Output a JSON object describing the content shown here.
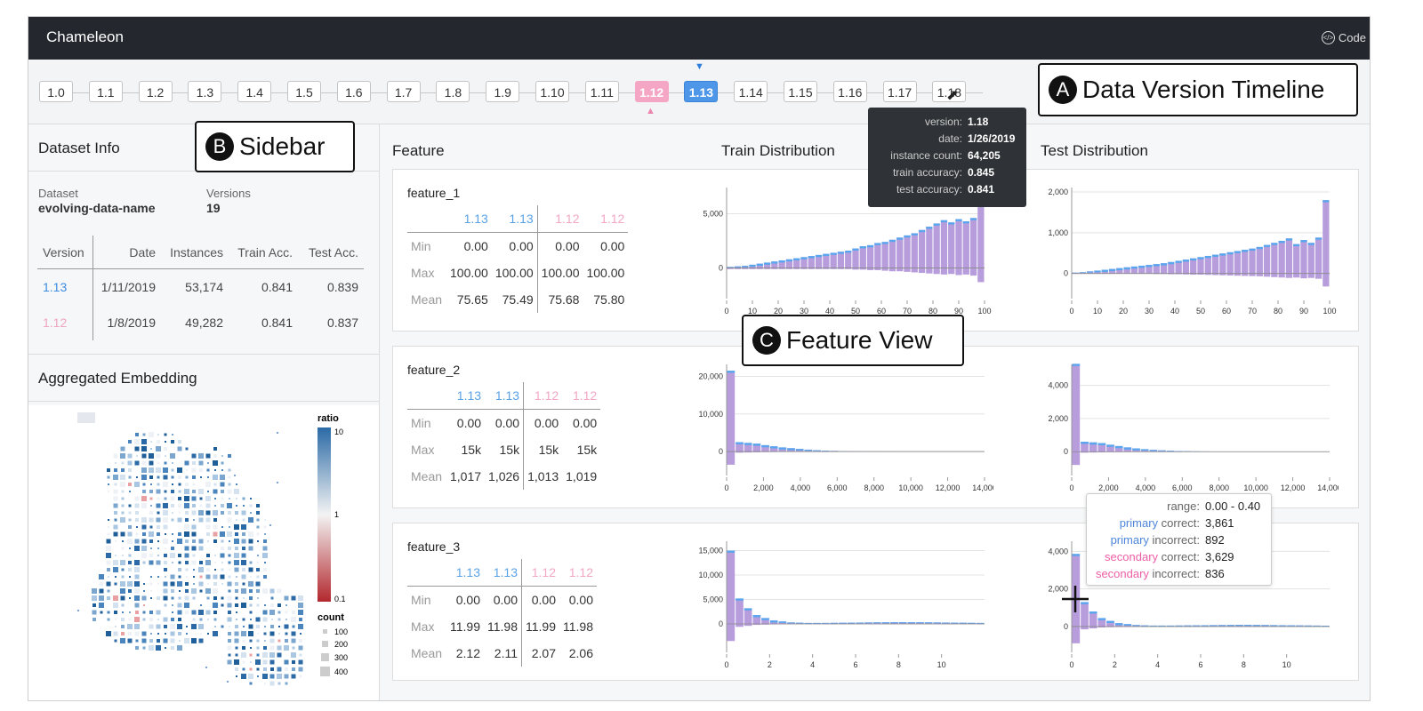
{
  "header": {
    "app_title": "Chameleon",
    "code_label": "Code"
  },
  "timeline": {
    "versions": [
      "1.0",
      "1.1",
      "1.2",
      "1.3",
      "1.4",
      "1.5",
      "1.6",
      "1.7",
      "1.8",
      "1.9",
      "1.10",
      "1.11",
      "1.12",
      "1.13",
      "1.14",
      "1.15",
      "1.16",
      "1.17",
      "1.18"
    ],
    "secondary_version": "1.12",
    "primary_version": "1.13",
    "hovered_version": "1.18"
  },
  "callouts": {
    "a": {
      "letter": "A",
      "text": "Data Version Timeline"
    },
    "b": {
      "letter": "B",
      "text": "Sidebar"
    },
    "c": {
      "letter": "C",
      "text": "Feature View"
    }
  },
  "version_tooltip": {
    "rows": [
      {
        "label": "version:",
        "value": "1.18"
      },
      {
        "label": "date:",
        "value": "1/26/2019"
      },
      {
        "label": "instance count:",
        "value": "64,205"
      },
      {
        "label": "train accuracy:",
        "value": "0.845"
      },
      {
        "label": "test accuracy:",
        "value": "0.841"
      }
    ]
  },
  "sidebar": {
    "dataset_info_title": "Dataset Info",
    "dataset_label": "Dataset",
    "dataset_name": "evolving-data-name",
    "versions_label": "Versions",
    "versions_count": "19",
    "table_headers": [
      "Version",
      "Date",
      "Instances",
      "Train Acc.",
      "Test Acc."
    ],
    "rows": [
      {
        "version": "1.13",
        "date": "1/11/2019",
        "instances": "53,174",
        "train": "0.841",
        "test": "0.839"
      },
      {
        "version": "1.12",
        "date": "1/8/2019",
        "instances": "49,282",
        "train": "0.841",
        "test": "0.837"
      }
    ],
    "embedding_title": "Aggregated Embedding",
    "ratio_label": "ratio",
    "ratio_ticks": [
      "10",
      "1",
      "0.1"
    ],
    "count_label": "count",
    "count_ticks": [
      "100",
      "200",
      "300",
      "400"
    ]
  },
  "features": {
    "col_feature": "Feature",
    "col_train": "Train Distribution",
    "col_test": "Test Distribution",
    "stat_labels": [
      "Min",
      "Max",
      "Mean"
    ],
    "items": [
      {
        "name": "feature_1",
        "headers": [
          "1.13",
          "1.13",
          "1.12",
          "1.12"
        ],
        "min": [
          "0.00",
          "0.00",
          "0.00",
          "0.00"
        ],
        "max": [
          "100.00",
          "100.00",
          "100.00",
          "100.00"
        ],
        "mean": [
          "75.65",
          "75.49",
          "75.68",
          "75.80"
        ]
      },
      {
        "name": "feature_2",
        "headers": [
          "1.13",
          "1.13",
          "1.12",
          "1.12"
        ],
        "min": [
          "0.00",
          "0.00",
          "0.00",
          "0.00"
        ],
        "max": [
          "15k",
          "15k",
          "15k",
          "15k"
        ],
        "mean": [
          "1,017",
          "1,026",
          "1,013",
          "1,019"
        ]
      },
      {
        "name": "feature_3",
        "headers": [
          "1.13",
          "1.13",
          "1.12",
          "1.12"
        ],
        "min": [
          "0.00",
          "0.00",
          "0.00",
          "0.00"
        ],
        "max": [
          "11.99",
          "11.98",
          "11.99",
          "11.98"
        ],
        "mean": [
          "2.12",
          "2.11",
          "2.07",
          "2.06"
        ]
      }
    ]
  },
  "bin_tooltip": {
    "rows": [
      {
        "label": "range:",
        "value": "0.00 - 0.40"
      },
      {
        "prefix": "primary",
        "label": " correct:",
        "value": "3,861"
      },
      {
        "prefix": "primary",
        "label": " incorrect:",
        "value": "892"
      },
      {
        "prefix": "secondary",
        "label": " correct:",
        "value": "3,629"
      },
      {
        "prefix": "secondary",
        "label": " incorrect:",
        "value": "836"
      }
    ]
  },
  "chart_data": [
    {
      "type": "bar",
      "name": "feature_1 train",
      "x_ticks": [
        "0",
        "10",
        "20",
        "30",
        "40",
        "50",
        "60",
        "70",
        "80",
        "90",
        "100"
      ],
      "y_ticks": [
        "5,000",
        "0"
      ],
      "ylim": [
        -2000,
        7000
      ],
      "values": [
        100,
        150,
        200,
        300,
        400,
        500,
        600,
        700,
        800,
        900,
        1000,
        1100,
        1200,
        1300,
        1400,
        1500,
        1600,
        1800,
        2000,
        2100,
        2300,
        2400,
        2600,
        2800,
        3000,
        3200,
        3500,
        3800,
        4100,
        4400,
        4200,
        4500,
        4300,
        4600,
        8200
      ],
      "negative": [
        -100,
        -100,
        -100,
        -100,
        -100,
        -100,
        -100,
        -100,
        -100,
        -100,
        -100,
        -100,
        -100,
        -100,
        -100,
        -100,
        -100,
        -150,
        -150,
        -200,
        -200,
        -250,
        -300,
        -300,
        -350,
        -400,
        -450,
        -500,
        -550,
        -600,
        -550,
        -650,
        -600,
        -700,
        -1300
      ]
    },
    {
      "type": "bar",
      "name": "feature_1 test",
      "x_ticks": [
        "0",
        "10",
        "20",
        "30",
        "40",
        "50",
        "60",
        "70",
        "80",
        "90",
        "100"
      ],
      "y_ticks": [
        "2,000",
        "1,000",
        "0"
      ],
      "ylim": [
        -400,
        2000
      ],
      "values": [
        20,
        30,
        50,
        70,
        90,
        110,
        130,
        150,
        170,
        190,
        210,
        230,
        250,
        280,
        310,
        340,
        370,
        400,
        430,
        460,
        490,
        520,
        550,
        580,
        610,
        650,
        700,
        750,
        800,
        860,
        720,
        820,
        750,
        880,
        1800
      ],
      "negative": [
        -10,
        -10,
        -10,
        -10,
        -10,
        -10,
        -10,
        -10,
        -10,
        -10,
        -10,
        -15,
        -15,
        -20,
        -20,
        -25,
        -30,
        -30,
        -35,
        -40,
        -45,
        -50,
        -55,
        -60,
        -65,
        -70,
        -80,
        -90,
        -100,
        -110,
        -100,
        -120,
        -110,
        -130,
        -320
      ]
    },
    {
      "type": "bar",
      "name": "feature_2 train",
      "x_ticks": [
        "0",
        "2,000",
        "4,000",
        "6,000",
        "8,000",
        "10,000",
        "12,000",
        "14,000"
      ],
      "y_ticks": [
        "20,000",
        "10,000",
        "0"
      ],
      "ylim": [
        -4000,
        22000
      ],
      "values": [
        21500,
        2500,
        2300,
        2100,
        1700,
        1400,
        1100,
        900,
        700,
        500,
        350,
        250,
        180,
        120,
        90,
        70,
        60,
        50,
        40,
        30,
        20,
        20,
        15,
        10,
        10,
        10,
        5,
        5,
        5,
        5
      ],
      "negative": [
        -3500,
        -300,
        -250,
        -200,
        -150,
        -120,
        -100,
        -80,
        -60,
        -40,
        -30,
        -20,
        -10,
        -10,
        -5,
        -5,
        -5,
        -5,
        -5,
        -5,
        0,
        0,
        0,
        0,
        0,
        0,
        0,
        0,
        0,
        0
      ]
    },
    {
      "type": "bar",
      "name": "feature_2 test",
      "x_ticks": [
        "0",
        "2,000",
        "4,000",
        "6,000",
        "8,000",
        "10,000",
        "12,000",
        "14,000"
      ],
      "y_ticks": [
        "4,000",
        "2,000",
        "0"
      ],
      "ylim": [
        -900,
        5000
      ],
      "values": [
        5300,
        600,
        560,
        520,
        420,
        340,
        260,
        200,
        150,
        110,
        80,
        60,
        40,
        30,
        20,
        15,
        12,
        10,
        8,
        6,
        5,
        4,
        3,
        2,
        2,
        2,
        1,
        1,
        1,
        1
      ],
      "negative": [
        -800,
        -60,
        -50,
        -40,
        -30,
        -25,
        -20,
        -15,
        -12,
        -10,
        -8,
        -6,
        -4,
        -3,
        -2,
        -2,
        -1,
        -1,
        -1,
        -1,
        0,
        0,
        0,
        0,
        0,
        0,
        0,
        0,
        0,
        0
      ]
    },
    {
      "type": "bar",
      "name": "feature_3 train",
      "x_ticks": [
        "0",
        "2",
        "4",
        "6",
        "8",
        "10"
      ],
      "y_ticks": [
        "15,000",
        "10,000",
        "5,000",
        "0"
      ],
      "ylim": [
        -4000,
        16000
      ],
      "values": [
        15000,
        5200,
        3200,
        1800,
        1200,
        700,
        500,
        300,
        250,
        200,
        200,
        200,
        220,
        240,
        260,
        280,
        300,
        320,
        330,
        340,
        350,
        340,
        330,
        320,
        300,
        280,
        260,
        240,
        220,
        200
      ],
      "negative": [
        -3500,
        -600,
        -400,
        -200,
        -150,
        -100,
        -60,
        -40,
        -30,
        -20,
        -20,
        -20,
        -25,
        -30,
        -30,
        -30,
        -35,
        -35,
        -40,
        -40,
        -40,
        -40,
        -35,
        -35,
        -30,
        -30,
        -30,
        -25,
        -25,
        -20
      ],
      "x_max": 12
    },
    {
      "type": "bar",
      "name": "feature_3 test",
      "x_ticks": [
        "0",
        "2",
        "4",
        "6",
        "8",
        "10"
      ],
      "y_ticks": [
        "4,000",
        "2,000",
        "0"
      ],
      "ylim": [
        -900,
        4300
      ],
      "values": [
        3861,
        1300,
        800,
        450,
        300,
        180,
        130,
        80,
        60,
        50,
        50,
        50,
        55,
        60,
        65,
        70,
        75,
        80,
        85,
        90,
        90,
        85,
        80,
        75,
        70,
        65,
        60,
        55,
        50,
        45
      ],
      "negative": [
        -892,
        -150,
        -100,
        -50,
        -35,
        -25,
        -15,
        -10,
        -8,
        -6,
        -6,
        -6,
        -7,
        -8,
        -8,
        -8,
        -9,
        -9,
        -10,
        -10,
        -10,
        -10,
        -9,
        -9,
        -8,
        -8,
        -7,
        -7,
        -6,
        -6
      ],
      "x_max": 12
    }
  ],
  "colors": {
    "primary": "#4e97e8",
    "secondary": "#f0a3c2",
    "bar": "#b89ddd",
    "bar_top": "#5aa6ee",
    "tooltip_primary": "#4e86dc",
    "tooltip_secondary": "#ee5fa7"
  }
}
